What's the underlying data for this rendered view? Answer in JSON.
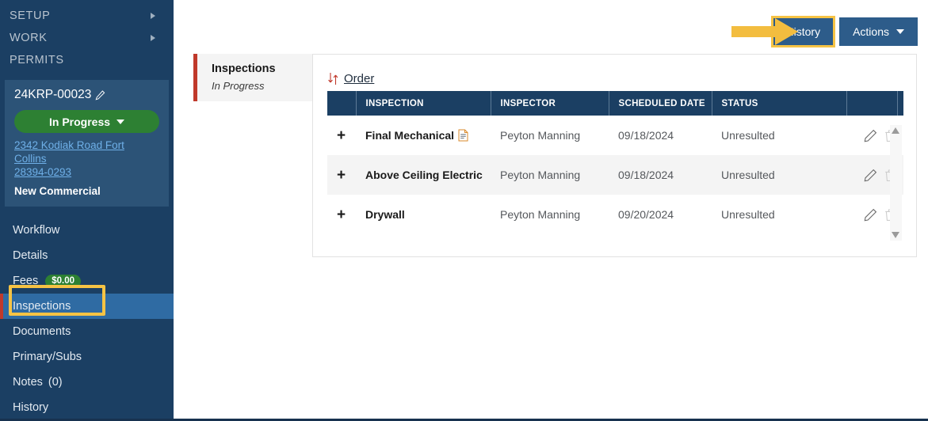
{
  "sidebar": {
    "top_nav": [
      {
        "label": "SETUP",
        "has_caret": true,
        "caret_icon": "chevron-right-icon"
      },
      {
        "label": "WORK",
        "has_caret": true,
        "caret_icon": "chevron-right-icon"
      },
      {
        "label": "PERMITS",
        "has_caret": false,
        "caret_icon": ""
      }
    ],
    "permit_card": {
      "permit_id": "24KRP-00023",
      "edit_icon": "pencil-icon",
      "status": "In Progress",
      "status_caret_icon": "caret-down-icon",
      "status_color": "#2d8033",
      "address_line1": "2342 Kodiak Road Fort Collins",
      "address_line2": "28394-0293",
      "permit_type": "New Commercial"
    },
    "menu": [
      {
        "label": "Workflow",
        "active": false
      },
      {
        "label": "Details",
        "active": false
      },
      {
        "label": "Fees",
        "badge": "$0.00",
        "active": false
      },
      {
        "label": "Inspections",
        "active": true
      },
      {
        "label": "Documents",
        "active": false
      },
      {
        "label": "Primary/Subs",
        "active": false
      },
      {
        "label": "Notes",
        "count": "(0)",
        "active": false
      },
      {
        "label": "History",
        "active": false
      }
    ],
    "active_color": "#2f6ba3",
    "accent_color": "#c0392b",
    "background_color": "#1b3f63"
  },
  "topbar": {
    "history_label": "History",
    "actions_label": "Actions",
    "actions_caret_icon": "caret-down-icon",
    "button_color": "#2d5c8a",
    "highlight_color": "#f6c344",
    "annotation_arrow_icon": "arrow-right-annotation"
  },
  "panel": {
    "tab_title": "Inspections",
    "tab_subtitle": "In Progress",
    "tab_accent_color": "#c0392b"
  },
  "table": {
    "order_label": "Order",
    "sort_icon": "sort-updown-icon",
    "columns": [
      "",
      "INSPECTION",
      "INSPECTOR",
      "SCHEDULED DATE",
      "STATUS",
      "",
      ""
    ],
    "header_color": "#1b3f63",
    "rows": [
      {
        "expand": "+",
        "inspection": "Final Mechanical",
        "has_doc_icon": true,
        "doc_icon": "document-icon",
        "inspector": "Peyton Manning",
        "scheduled_date": "09/18/2024",
        "status": "Unresulted",
        "edit_icon": "pencil-icon",
        "delete_icon": "trash-icon"
      },
      {
        "expand": "+",
        "inspection": "Above Ceiling Electric",
        "has_doc_icon": false,
        "doc_icon": "",
        "inspector": "Peyton Manning",
        "scheduled_date": "09/18/2024",
        "status": "Unresulted",
        "edit_icon": "pencil-icon",
        "delete_icon": "trash-icon"
      },
      {
        "expand": "+",
        "inspection": "Drywall",
        "has_doc_icon": false,
        "doc_icon": "",
        "inspector": "Peyton Manning",
        "scheduled_date": "09/20/2024",
        "status": "Unresulted",
        "edit_icon": "pencil-icon",
        "delete_icon": "trash-icon"
      }
    ],
    "scrollbar": {
      "up_icon": "scroll-up-arrow-icon",
      "down_icon": "scroll-down-arrow-icon"
    }
  }
}
